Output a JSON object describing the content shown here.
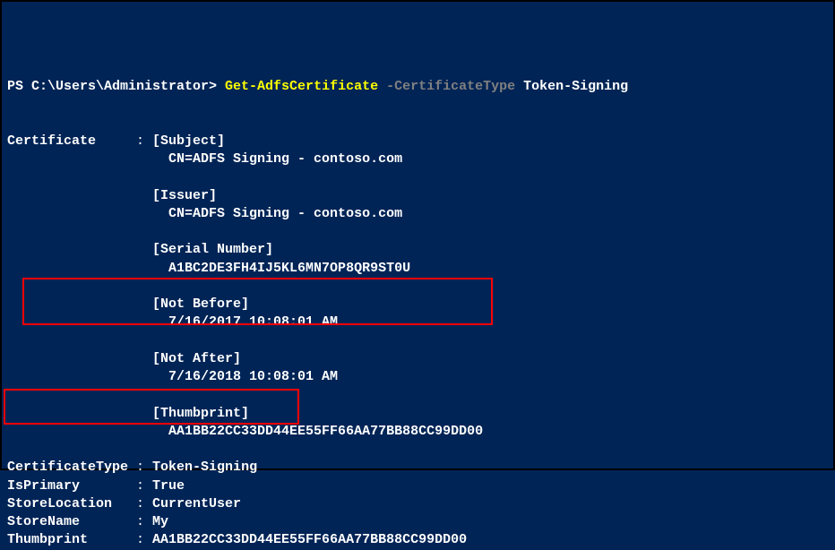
{
  "prompt": "PS C:\\Users\\Administrator> ",
  "command": {
    "cmdlet": "Get-AdfsCertificate",
    "param": " -CertificateType",
    "value": " Token-Signing"
  },
  "output": {
    "certificate_label": "Certificate",
    "subject_header": "[Subject]",
    "subject_value": "CN=ADFS Signing - contoso.com",
    "issuer_header": "[Issuer]",
    "issuer_value": "CN=ADFS Signing - contoso.com",
    "serial_header": "[Serial Number]",
    "serial_value": "A1BC2DE3FH4IJ5KL6MN7OP8QR9ST0U",
    "not_before_header": "[Not Before]",
    "not_before_value": "7/16/2017 10:08:01 AM",
    "not_after_header": "[Not After]",
    "not_after_value": "7/16/2018 10:08:01 AM",
    "thumbprint_header": "[Thumbprint]",
    "thumbprint_value": "AA1BB22CC33DD44EE55FF66AA77BB88CC99DD00",
    "cert_type_label": "CertificateType",
    "cert_type_value": "Token-Signing",
    "is_primary_label": "IsPrimary",
    "is_primary_value": "True",
    "store_location_label": "StoreLocation",
    "store_location_value": "CurrentUser",
    "store_name_label": "StoreName",
    "store_name_value": "My",
    "thumbprint_label": "Thumbprint",
    "thumbprint_value2": "AA1BB22CC33DD44EE55FF66AA77BB88CC99DD00"
  }
}
